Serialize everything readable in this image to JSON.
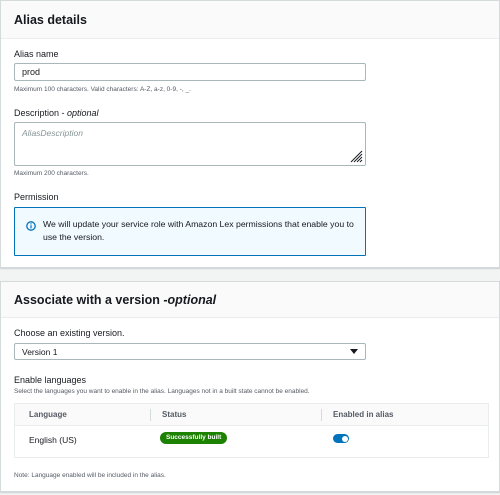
{
  "alias_details": {
    "title": "Alias details",
    "alias_name": {
      "label": "Alias name",
      "value": "prod",
      "hint": "Maximum 100 characters. Valid characters: A-Z, a-z, 0-9, -, _."
    },
    "description": {
      "label": "Description - ",
      "label_optional": "optional",
      "placeholder": "AliasDescription",
      "hint": "Maximum 200 characters."
    },
    "permission": {
      "label": "Permission",
      "info_text": "We will update your service role with Amazon Lex permissions that enable you to use the version."
    }
  },
  "associate_version": {
    "title": "Associate with a version - ",
    "title_optional": "optional",
    "version_select": {
      "label": "Choose an existing version.",
      "value": "Version 1"
    },
    "languages": {
      "label": "Enable languages",
      "description": "Select the languages you want to enable in the alias. Languages not in a built state cannot be enabled.",
      "columns": [
        "Language",
        "Status",
        "Enabled in alias"
      ],
      "rows": [
        {
          "language": "English (US)",
          "status": "Successfully built",
          "enabled": true
        }
      ],
      "note": "Note: Language enabled will be included in the alias."
    }
  },
  "colors": {
    "accent": "#0073bb",
    "success": "#1d8102",
    "info_background": "#f1faff"
  }
}
